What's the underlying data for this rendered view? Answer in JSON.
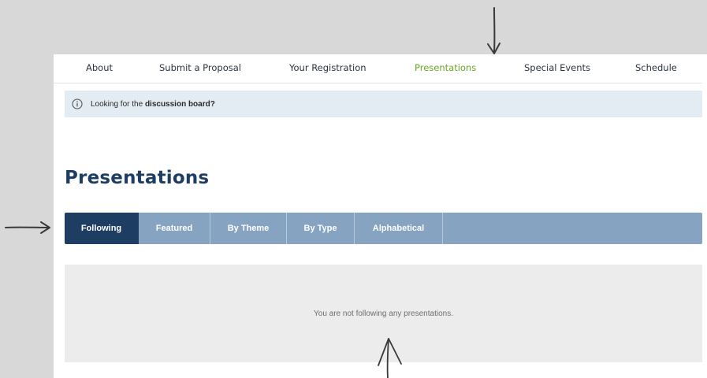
{
  "nav": {
    "items": [
      {
        "label": "About",
        "active": false
      },
      {
        "label": "Submit a Proposal",
        "active": false
      },
      {
        "label": "Your Registration",
        "active": false
      },
      {
        "label": "Presentations",
        "active": true
      },
      {
        "label": "Special Events",
        "active": false
      },
      {
        "label": "Schedule",
        "active": false
      }
    ]
  },
  "notice": {
    "icon": "info-icon",
    "text": "Looking for the ",
    "link_label": "discussion board?"
  },
  "main": {
    "title": "Presentations",
    "tabs": [
      {
        "label": "Following",
        "active": true
      },
      {
        "label": "Featured",
        "active": false
      },
      {
        "label": "By Theme",
        "active": false
      },
      {
        "label": "By Type",
        "active": false
      },
      {
        "label": "Alphabetical",
        "active": false
      }
    ],
    "empty_message": "You are not following any presentations."
  },
  "colors": {
    "active_nav": "#6aa626",
    "heading": "#1e3d63",
    "active_tab": "#1e3d63",
    "tab_bar": "#87a3c2",
    "notice_bg": "#e3ecf3"
  }
}
